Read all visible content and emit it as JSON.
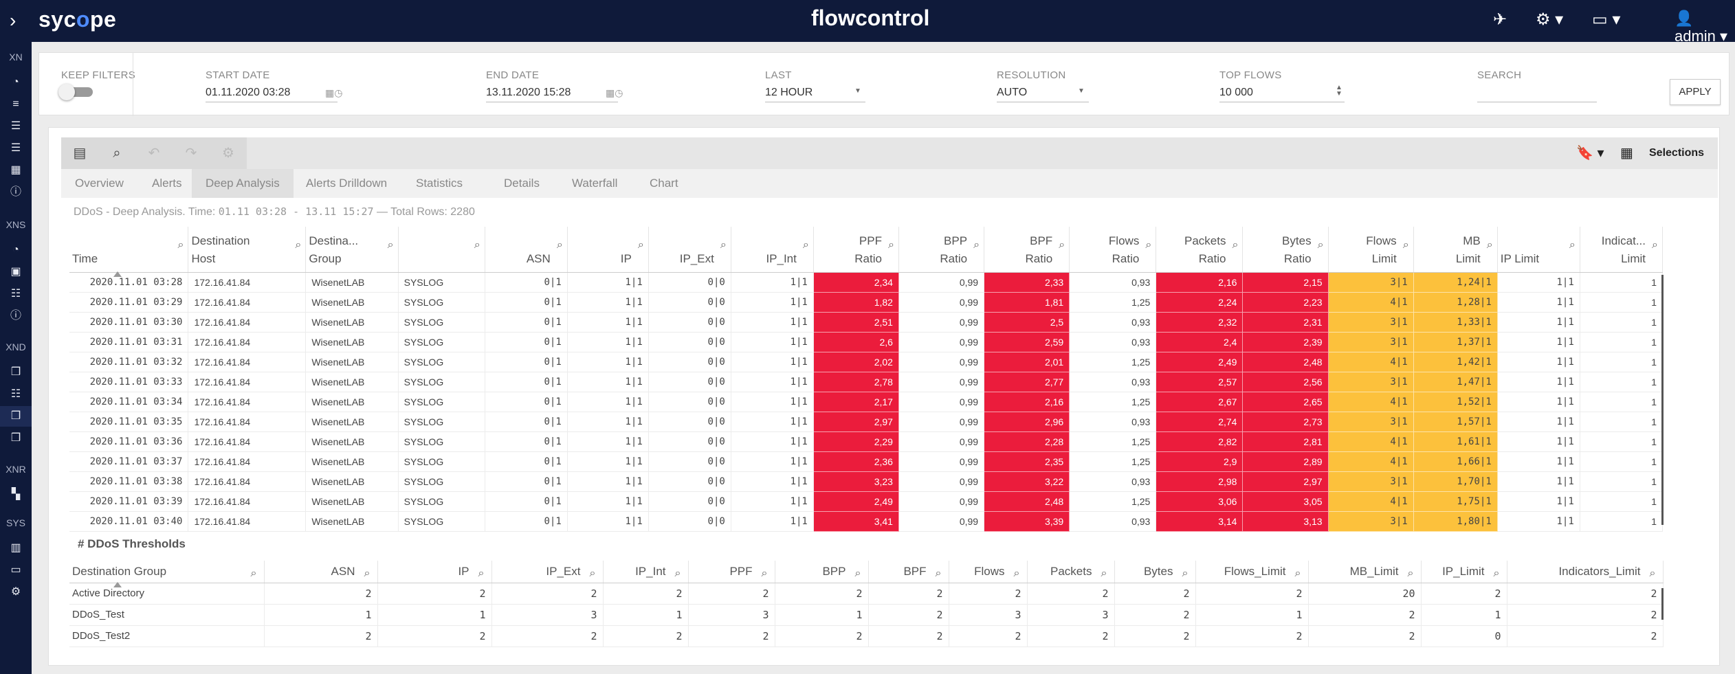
{
  "topbar": {
    "logo_a": "syc",
    "logo_b": "o",
    "logo_c": "pe",
    "app_title": "flowcontrol",
    "user": "admin"
  },
  "sidebar": {
    "sections": [
      "XN",
      "XNS",
      "XND",
      "XNR",
      "SYS"
    ]
  },
  "filters": {
    "keep_filters_label": "KEEP FILTERS",
    "start_date_label": "START DATE",
    "start_date": "01.11.2020 03:28",
    "end_date_label": "END DATE",
    "end_date": "13.11.2020 15:28",
    "last_label": "LAST",
    "last": "12 HOUR",
    "resolution_label": "RESOLUTION",
    "resolution": "AUTO",
    "top_flows_label": "TOP FLOWS",
    "top_flows": "10 000",
    "search_label": "SEARCH",
    "search": "",
    "apply_label": "APPLY"
  },
  "toolbar": {
    "selections_label": "Selections"
  },
  "tabs": [
    "Overview",
    "Alerts",
    "Deep Analysis",
    "Alerts Drilldown",
    "Statistics",
    "Details",
    "Waterfall",
    "Chart"
  ],
  "info": {
    "prefix": "DDoS - Deep Analysis. Time: ",
    "range": "01.11 03:28 - 13.11 15:27",
    "suffix": " — Total Rows: 2280"
  },
  "main_table": {
    "headers": [
      [
        "Time"
      ],
      [
        "Destination",
        "Host"
      ],
      [
        "Destina...",
        "Group"
      ],
      [
        ""
      ],
      [
        "ASN"
      ],
      [
        "IP"
      ],
      [
        "IP_Ext"
      ],
      [
        "IP_Int"
      ],
      [
        "PPF",
        "Ratio"
      ],
      [
        "BPP",
        "Ratio"
      ],
      [
        "BPF",
        "Ratio"
      ],
      [
        "Flows",
        "Ratio"
      ],
      [
        "Packets",
        "Ratio"
      ],
      [
        "Bytes",
        "Ratio"
      ],
      [
        "Flows",
        "Limit"
      ],
      [
        "MB",
        "Limit"
      ],
      [
        "IP Limit"
      ],
      [
        "Indicat...",
        "Limit"
      ]
    ],
    "rows": [
      [
        "2020.11.01 03:28",
        "172.16.41.84",
        "WisenetLAB",
        "SYSLOG",
        "0|1",
        "1|1",
        "0|0",
        "1|1",
        "2,34",
        "0,99",
        "2,33",
        "0,93",
        "2,16",
        "2,15",
        "3|1",
        "1,24|1",
        "1|1",
        "1"
      ],
      [
        "2020.11.01 03:29",
        "172.16.41.84",
        "WisenetLAB",
        "SYSLOG",
        "0|1",
        "1|1",
        "0|0",
        "1|1",
        "1,82",
        "0,99",
        "1,81",
        "1,25",
        "2,24",
        "2,23",
        "4|1",
        "1,28|1",
        "1|1",
        "1"
      ],
      [
        "2020.11.01 03:30",
        "172.16.41.84",
        "WisenetLAB",
        "SYSLOG",
        "0|1",
        "1|1",
        "0|0",
        "1|1",
        "2,51",
        "0,99",
        "2,5",
        "0,93",
        "2,32",
        "2,31",
        "3|1",
        "1,33|1",
        "1|1",
        "1"
      ],
      [
        "2020.11.01 03:31",
        "172.16.41.84",
        "WisenetLAB",
        "SYSLOG",
        "0|1",
        "1|1",
        "0|0",
        "1|1",
        "2,6",
        "0,99",
        "2,59",
        "0,93",
        "2,4",
        "2,39",
        "3|1",
        "1,37|1",
        "1|1",
        "1"
      ],
      [
        "2020.11.01 03:32",
        "172.16.41.84",
        "WisenetLAB",
        "SYSLOG",
        "0|1",
        "1|1",
        "0|0",
        "1|1",
        "2,02",
        "0,99",
        "2,01",
        "1,25",
        "2,49",
        "2,48",
        "4|1",
        "1,42|1",
        "1|1",
        "1"
      ],
      [
        "2020.11.01 03:33",
        "172.16.41.84",
        "WisenetLAB",
        "SYSLOG",
        "0|1",
        "1|1",
        "0|0",
        "1|1",
        "2,78",
        "0,99",
        "2,77",
        "0,93",
        "2,57",
        "2,56",
        "3|1",
        "1,47|1",
        "1|1",
        "1"
      ],
      [
        "2020.11.01 03:34",
        "172.16.41.84",
        "WisenetLAB",
        "SYSLOG",
        "0|1",
        "1|1",
        "0|0",
        "1|1",
        "2,17",
        "0,99",
        "2,16",
        "1,25",
        "2,67",
        "2,65",
        "4|1",
        "1,52|1",
        "1|1",
        "1"
      ],
      [
        "2020.11.01 03:35",
        "172.16.41.84",
        "WisenetLAB",
        "SYSLOG",
        "0|1",
        "1|1",
        "0|0",
        "1|1",
        "2,97",
        "0,99",
        "2,96",
        "0,93",
        "2,74",
        "2,73",
        "3|1",
        "1,57|1",
        "1|1",
        "1"
      ],
      [
        "2020.11.01 03:36",
        "172.16.41.84",
        "WisenetLAB",
        "SYSLOG",
        "0|1",
        "1|1",
        "0|0",
        "1|1",
        "2,29",
        "0,99",
        "2,28",
        "1,25",
        "2,82",
        "2,81",
        "4|1",
        "1,61|1",
        "1|1",
        "1"
      ],
      [
        "2020.11.01 03:37",
        "172.16.41.84",
        "WisenetLAB",
        "SYSLOG",
        "0|1",
        "1|1",
        "0|0",
        "1|1",
        "2,36",
        "0,99",
        "2,35",
        "1,25",
        "2,9",
        "2,89",
        "4|1",
        "1,66|1",
        "1|1",
        "1"
      ],
      [
        "2020.11.01 03:38",
        "172.16.41.84",
        "WisenetLAB",
        "SYSLOG",
        "0|1",
        "1|1",
        "0|0",
        "1|1",
        "3,23",
        "0,99",
        "3,22",
        "0,93",
        "2,98",
        "2,97",
        "3|1",
        "1,70|1",
        "1|1",
        "1"
      ],
      [
        "2020.11.01 03:39",
        "172.16.41.84",
        "WisenetLAB",
        "SYSLOG",
        "0|1",
        "1|1",
        "0|0",
        "1|1",
        "2,49",
        "0,99",
        "2,48",
        "1,25",
        "3,06",
        "3,05",
        "4|1",
        "1,75|1",
        "1|1",
        "1"
      ],
      [
        "2020.11.01 03:40",
        "172.16.41.84",
        "WisenetLAB",
        "SYSLOG",
        "0|1",
        "1|1",
        "0|0",
        "1|1",
        "3,41",
        "0,99",
        "3,39",
        "0,93",
        "3,14",
        "3,13",
        "3|1",
        "1,80|1",
        "1|1",
        "1"
      ]
    ]
  },
  "thresholds": {
    "title": "# DDoS Thresholds",
    "headers": [
      "Destination Group",
      "ASN",
      "IP",
      "IP_Ext",
      "IP_Int",
      "PPF",
      "BPP",
      "BPF",
      "Flows",
      "Packets",
      "Bytes",
      "Flows_Limit",
      "MB_Limit",
      "IP_Limit",
      "Indicators_Limit"
    ],
    "rows": [
      [
        "Active Directory",
        "2",
        "2",
        "2",
        "2",
        "2",
        "2",
        "2",
        "2",
        "2",
        "2",
        "2",
        "20",
        "2",
        "2"
      ],
      [
        "DDoS_Test",
        "1",
        "1",
        "3",
        "1",
        "3",
        "1",
        "2",
        "3",
        "3",
        "2",
        "1",
        "2",
        "1",
        "2"
      ],
      [
        "DDoS_Test2",
        "2",
        "2",
        "2",
        "2",
        "2",
        "2",
        "2",
        "2",
        "2",
        "2",
        "2",
        "2",
        "0",
        "2"
      ]
    ]
  },
  "colors": {
    "navy": "#0f1a3a",
    "alert_red": "#eb1c3c",
    "warn_yellow": "#fcc13c"
  }
}
